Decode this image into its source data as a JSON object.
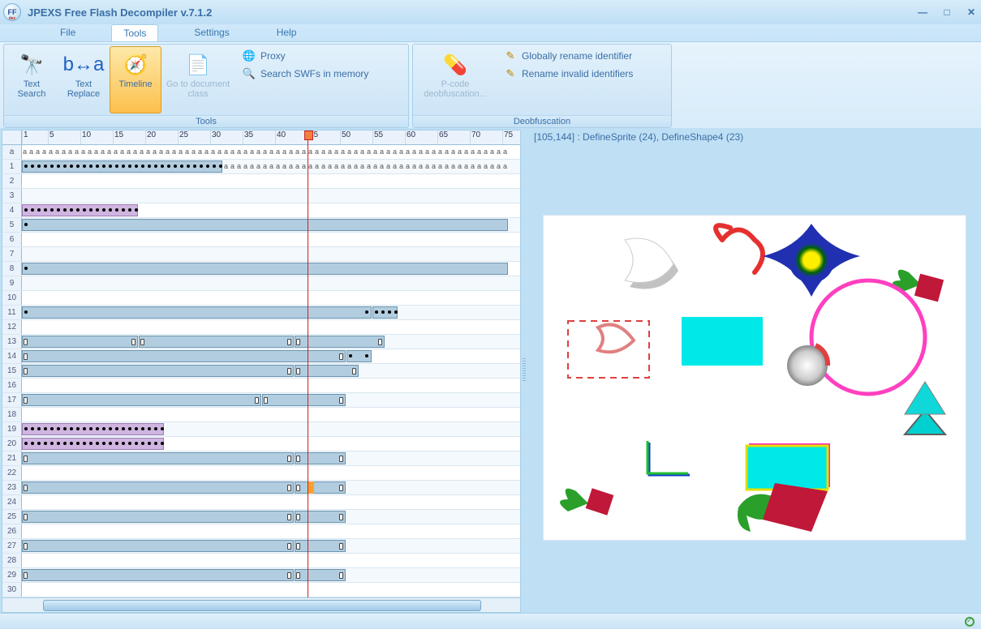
{
  "title": "JPEXS Free Flash Decompiler v.7.1.2",
  "menu": {
    "file": "File",
    "tools": "Tools",
    "settings": "Settings",
    "help": "Help"
  },
  "ribbon": {
    "groups": {
      "tools": {
        "label": "Tools",
        "text_search": "Text\nSearch",
        "text_replace": "Text\nReplace",
        "timeline": "Timeline",
        "goto_doc": "Go to document\nclass",
        "proxy": "Proxy",
        "search_mem": "Search SWFs in memory"
      },
      "deobf": {
        "label": "Deobfuscation",
        "pcode": "P-code\ndeobfuscation...",
        "global_rename": "Globally rename identifier",
        "rename_invalid": "Rename invalid identifiers"
      }
    }
  },
  "timeline": {
    "ruler_ticks": [
      1,
      5,
      10,
      15,
      20,
      25,
      30,
      35,
      40,
      45,
      50,
      55,
      60,
      65,
      70,
      75
    ],
    "playhead_frame": 45,
    "frame_width": 8,
    "rows": [
      {
        "n": "a",
        "clips": [],
        "letters_from": 1,
        "letters_to": 75
      },
      {
        "n": 1,
        "clips": [
          {
            "s": 1,
            "e": 31,
            "kfs": "dots"
          }
        ],
        "letters_from": 25,
        "letters_to": 75
      },
      {
        "n": 2
      },
      {
        "n": 3
      },
      {
        "n": 4,
        "clips": [
          {
            "s": 1,
            "e": 18,
            "kfs": "dots",
            "purple": true
          }
        ]
      },
      {
        "n": 5,
        "clips": [
          {
            "s": 1,
            "e": 75,
            "kfs": "start"
          }
        ]
      },
      {
        "n": 6
      },
      {
        "n": 7
      },
      {
        "n": 8,
        "clips": [
          {
            "s": 1,
            "e": 75,
            "kfs": "start"
          }
        ]
      },
      {
        "n": 9
      },
      {
        "n": 10
      },
      {
        "n": 11,
        "clips": [
          {
            "s": 1,
            "e": 54,
            "kfs": "startend"
          },
          {
            "s": 55,
            "e": 58,
            "kfs": "dots"
          }
        ]
      },
      {
        "n": 12
      },
      {
        "n": 13,
        "clips": [
          {
            "s": 1,
            "e": 18,
            "kfs": "hollow2"
          },
          {
            "s": 19,
            "e": 42,
            "kfs": "hollow2"
          },
          {
            "s": 43,
            "e": 56,
            "kfs": "hollow2"
          }
        ]
      },
      {
        "n": 14,
        "clips": [
          {
            "s": 1,
            "e": 50,
            "kfs": "hollow2"
          },
          {
            "s": 51,
            "e": 54,
            "kfs": "startend"
          }
        ]
      },
      {
        "n": 15,
        "clips": [
          {
            "s": 1,
            "e": 42,
            "kfs": "hollow2"
          },
          {
            "s": 43,
            "e": 52,
            "kfs": "hollow2"
          }
        ]
      },
      {
        "n": 16
      },
      {
        "n": 17,
        "clips": [
          {
            "s": 1,
            "e": 37,
            "kfs": "hollow2"
          },
          {
            "s": 38,
            "e": 50,
            "kfs": "hollow2"
          }
        ]
      },
      {
        "n": 18
      },
      {
        "n": 19,
        "clips": [
          {
            "s": 1,
            "e": 22,
            "kfs": "dots",
            "purple": true
          }
        ]
      },
      {
        "n": 20,
        "clips": [
          {
            "s": 1,
            "e": 22,
            "kfs": "dots",
            "purple": true
          }
        ]
      },
      {
        "n": 21,
        "clips": [
          {
            "s": 1,
            "e": 42,
            "kfs": "hollow2"
          },
          {
            "s": 43,
            "e": 50,
            "kfs": "hollow2"
          }
        ]
      },
      {
        "n": 22
      },
      {
        "n": 23,
        "clips": [
          {
            "s": 1,
            "e": 42,
            "kfs": "hollow2"
          },
          {
            "s": 43,
            "e": 50,
            "kfs": "hollow2"
          }
        ],
        "accent": 45
      },
      {
        "n": 24
      },
      {
        "n": 25,
        "clips": [
          {
            "s": 1,
            "e": 42,
            "kfs": "hollow2"
          },
          {
            "s": 43,
            "e": 50,
            "kfs": "hollow2"
          }
        ]
      },
      {
        "n": 26
      },
      {
        "n": 27,
        "clips": [
          {
            "s": 1,
            "e": 42,
            "kfs": "hollow2"
          },
          {
            "s": 43,
            "e": 50,
            "kfs": "hollow2"
          }
        ]
      },
      {
        "n": 28
      },
      {
        "n": 29,
        "clips": [
          {
            "s": 1,
            "e": 42,
            "kfs": "hollow2"
          },
          {
            "s": 43,
            "e": 50,
            "kfs": "hollow2"
          }
        ]
      },
      {
        "n": 30
      }
    ]
  },
  "preview": {
    "coord_text": "[105,144] : DefineSprite (24), DefineShape4 (23)"
  }
}
